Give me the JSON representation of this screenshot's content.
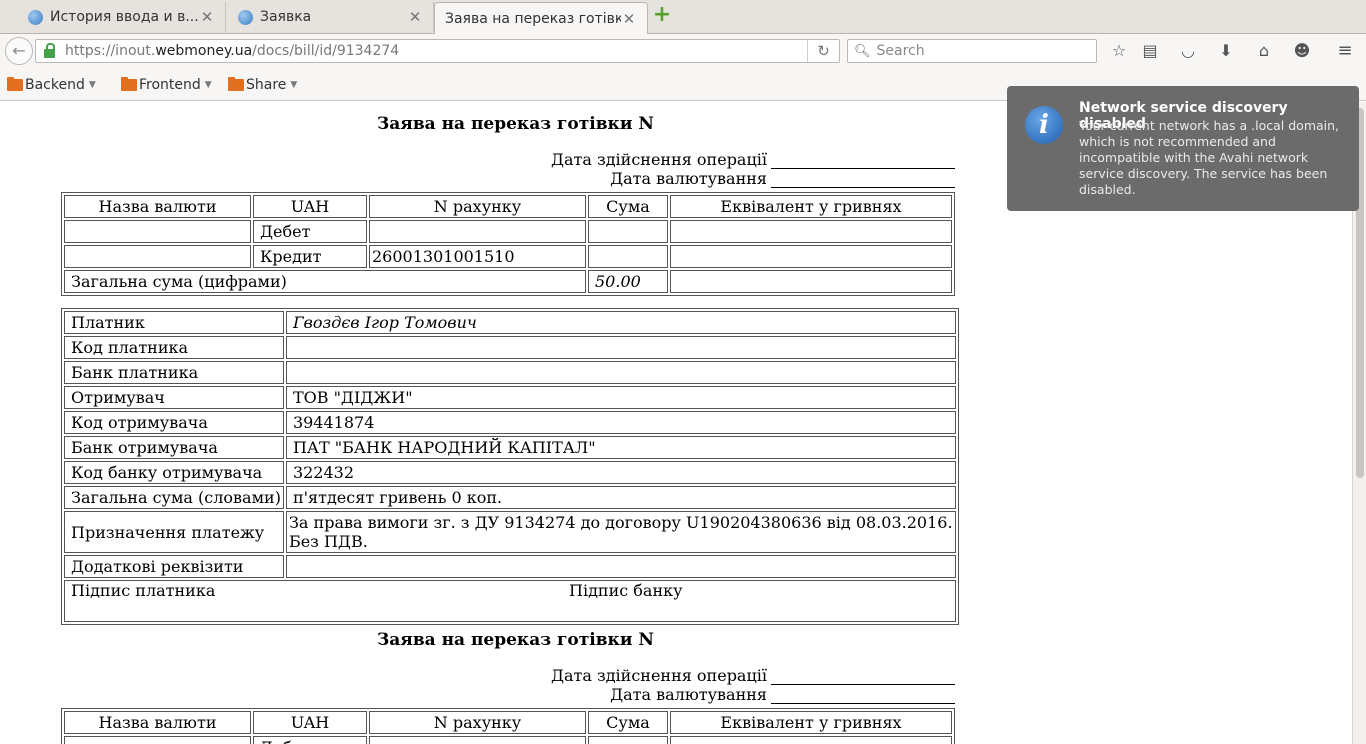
{
  "tabs": [
    {
      "title": "История ввода и в...",
      "active": false
    },
    {
      "title": "Заявка",
      "active": false
    },
    {
      "title": "Заява на переказ готівки",
      "active": true
    }
  ],
  "nav": {
    "url_prefix": "https://inout.",
    "url_host": "webmoney.ua",
    "url_path": "/docs/bill/id/9134274",
    "search_placeholder": "Search"
  },
  "bookmarks": [
    {
      "label": "Backend"
    },
    {
      "label": "Frontend"
    },
    {
      "label": "Share"
    }
  ],
  "notification": {
    "title": "Network service discovery disabled",
    "body": "Your current network has a .local domain, which is not recommended and incompatible with the Avahi network service discovery. The service has been disabled."
  },
  "document": {
    "title": "Заява на переказ готівки N",
    "operation_date_label": "Дата здійснення операції",
    "value_date_label": "Дата валютування",
    "currency_table": {
      "headers": [
        "Назва валюти",
        "UAH",
        "N рахунку",
        "Сума",
        "Еквівалент у гривнях"
      ],
      "debit_label": "Дебет",
      "credit_label": "Кредит",
      "credit_account": "26001301001510",
      "total_label": "Загальна сума (цифрами)",
      "total_value": "50.00"
    },
    "details": {
      "payer_label": "Платник",
      "payer_value": "Гвоздєв Ігор Томович",
      "payer_code_label": "Код платника",
      "payer_bank_label": "Банк платника",
      "recipient_label": "Отримувач",
      "recipient_value": "ТОВ \"ДІДЖИ\"",
      "recipient_code_label": "Код отримувача",
      "recipient_code_value": "39441874",
      "recipient_bank_label": "Банк отримувача",
      "recipient_bank_value": "ПАТ \"БАНК НАРОДНИЙ КАПІТАЛ\"",
      "recipient_bank_code_label": "Код банку отримувача",
      "recipient_bank_code_value": "322432",
      "total_words_label": "Загальна сума (словами)",
      "total_words_value": "п'ятдесят гривень 0 коп.",
      "purpose_label": "Призначення платежу",
      "purpose_line1": "За права вимоги зг. з ДУ 9134274 до договору U190204380636 від 08.03.2016.",
      "purpose_line2": "Без ПДВ.",
      "extra_label": "Додаткові реквізити",
      "payer_sign_label": "Підпис платника",
      "bank_sign_label": "Підпис банку"
    }
  }
}
